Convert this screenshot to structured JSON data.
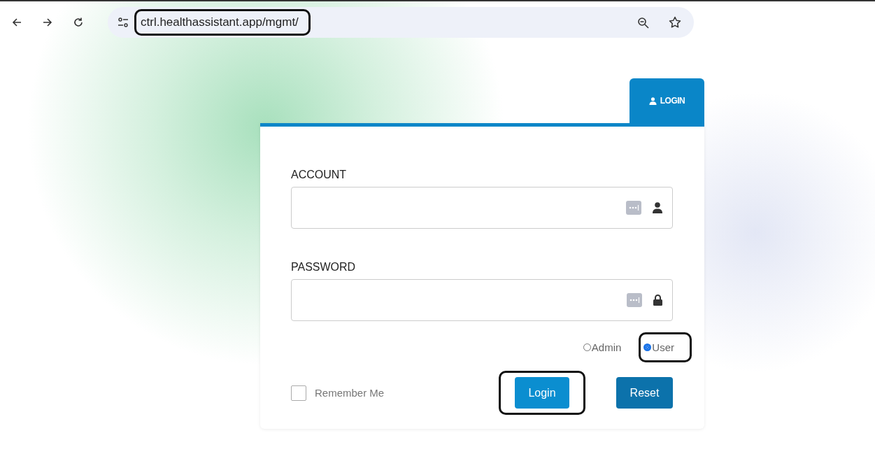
{
  "browser": {
    "url": "ctrl.healthassistant.app/mgmt/",
    "url_highlighted": true
  },
  "login_tab": {
    "label": "LOGIN",
    "selected": true
  },
  "form": {
    "fields": [
      {
        "label": "ACCOUNT",
        "kind": "account"
      },
      {
        "label": "PASSWORD",
        "kind": "password"
      }
    ],
    "roles": [
      {
        "label": "Admin",
        "selected": false,
        "highlighted": false
      },
      {
        "label": "User",
        "selected": true,
        "highlighted": true
      }
    ],
    "remember": {
      "label": "Remember Me",
      "checked": false
    },
    "buttons": [
      {
        "label": "Login",
        "kind": "primary",
        "highlighted": true
      },
      {
        "label": "Reset",
        "kind": "secondary",
        "highlighted": false
      }
    ]
  }
}
